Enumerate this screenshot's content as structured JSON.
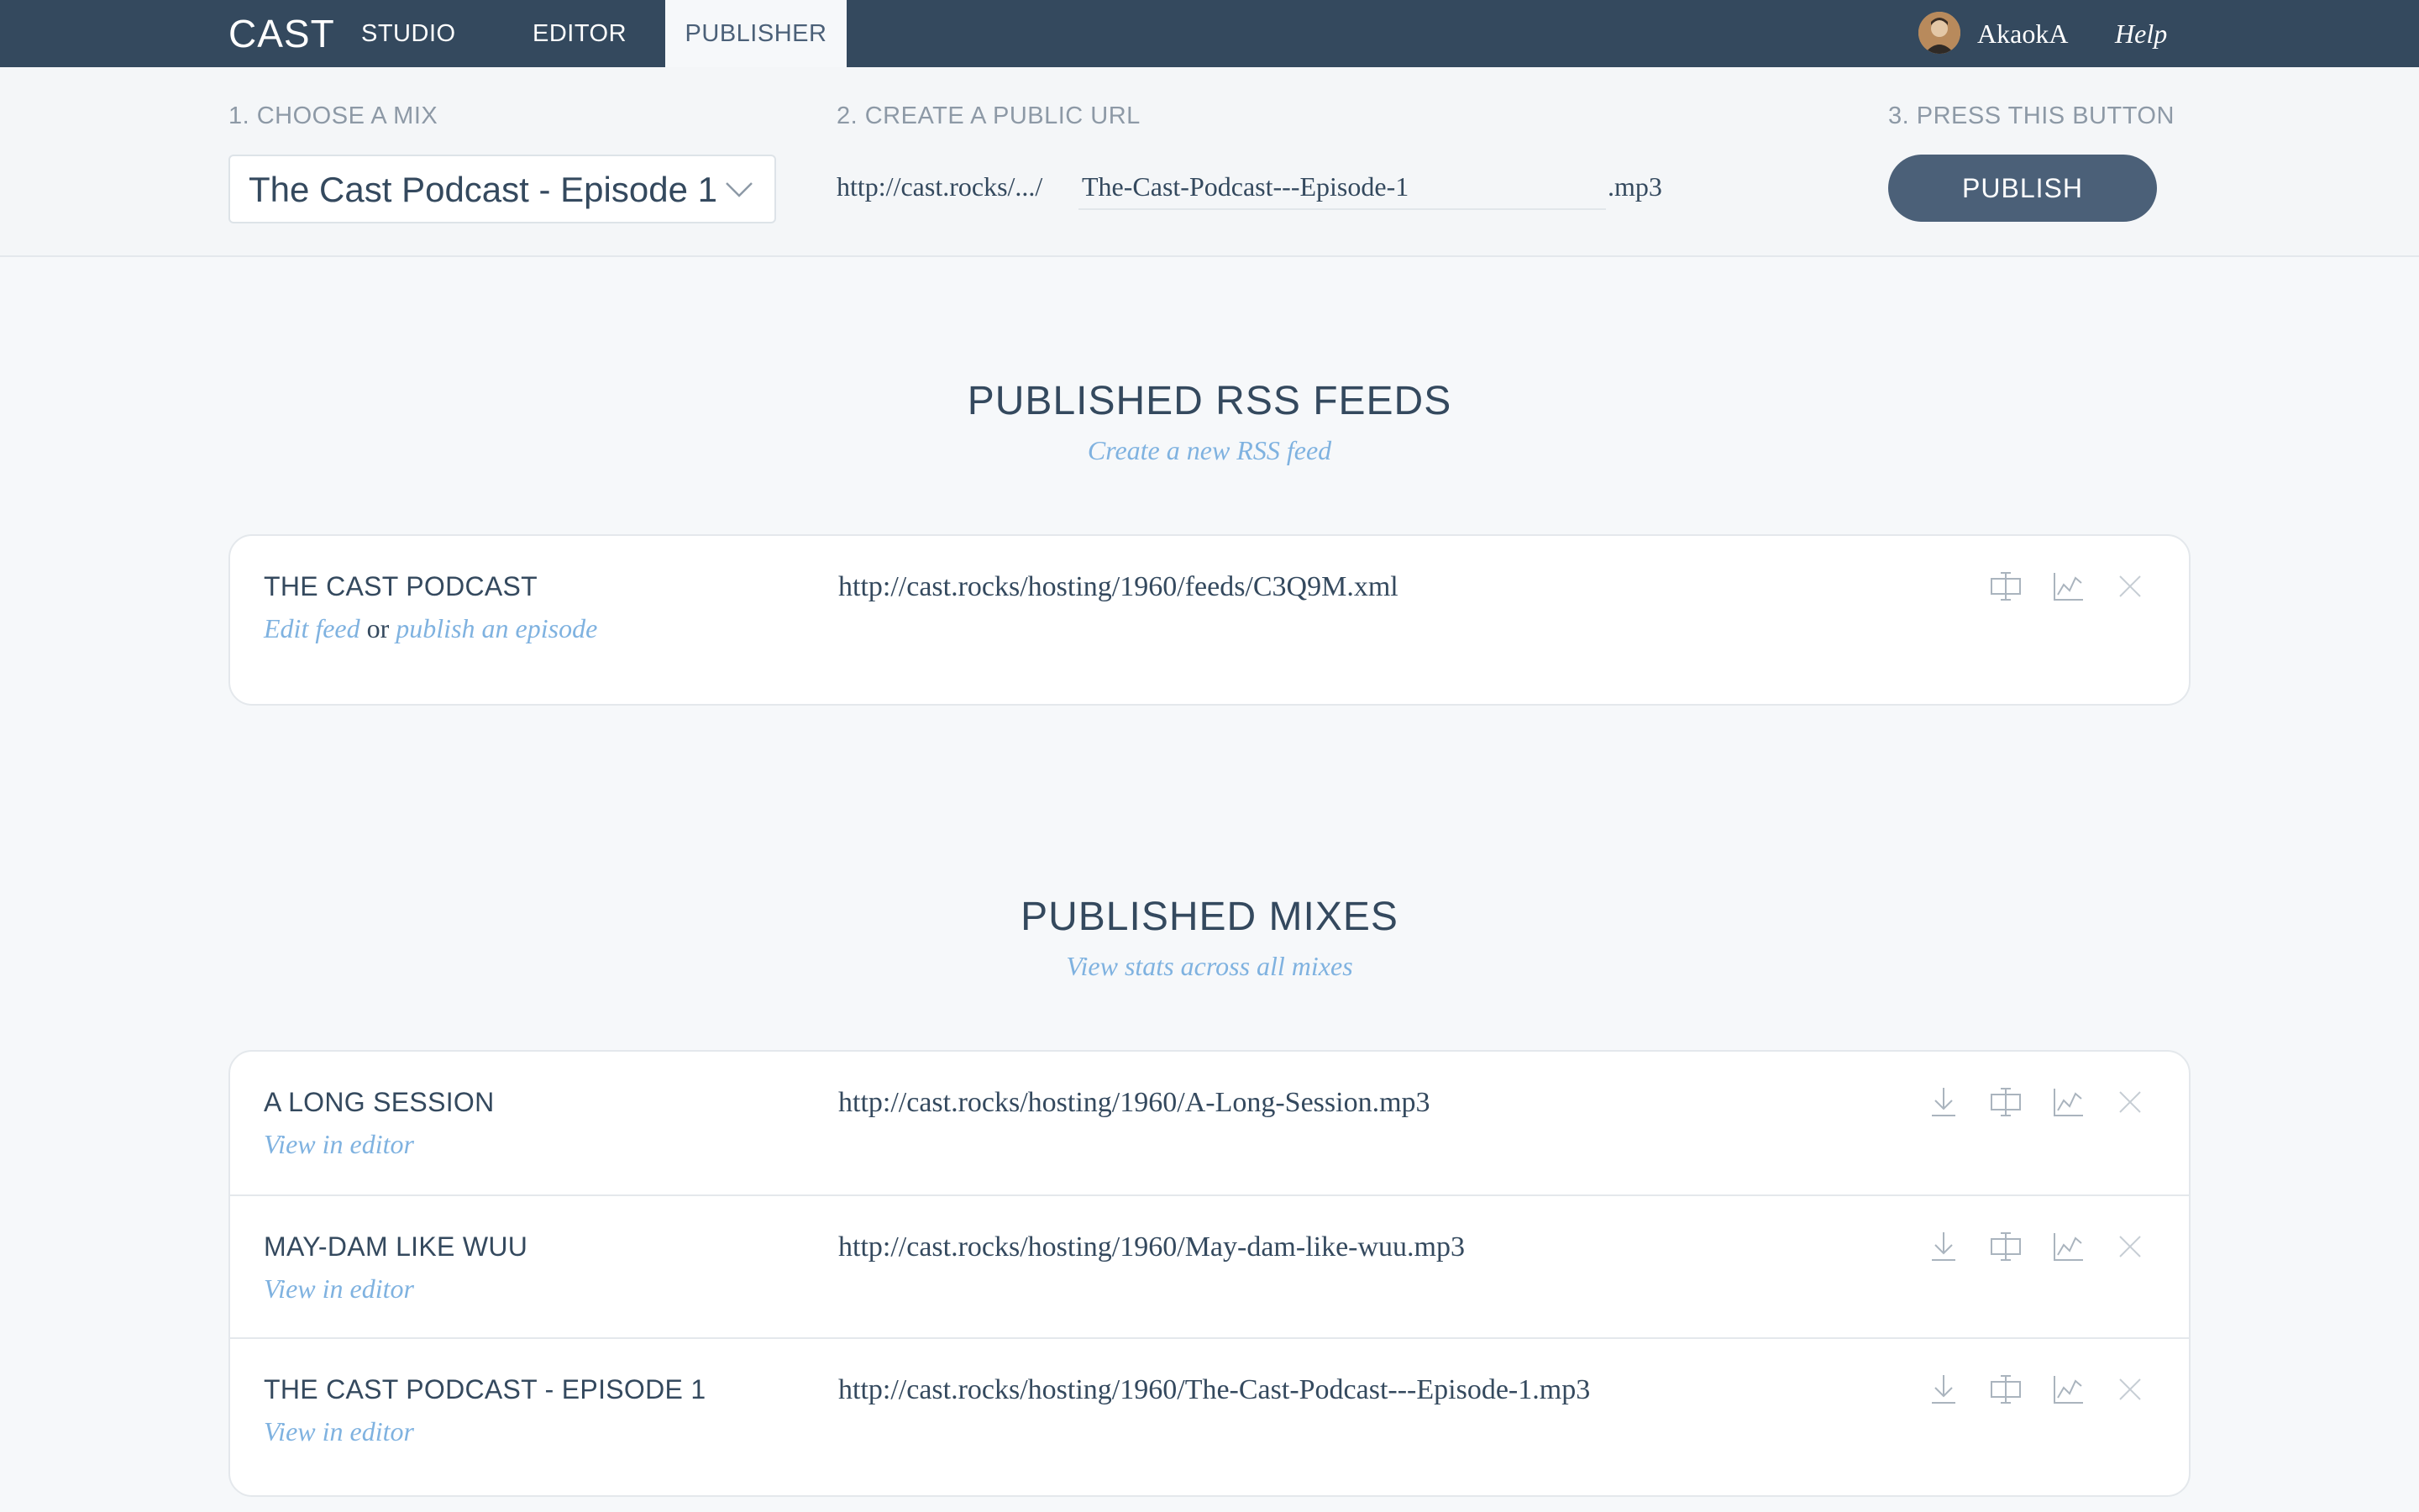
{
  "nav": {
    "logo": "CAST",
    "tabs": [
      {
        "label": "STUDIO"
      },
      {
        "label": "EDITOR"
      },
      {
        "label": "PUBLISHER"
      }
    ],
    "active_tab": "PUBLISHER",
    "user": {
      "name": "AkaokA",
      "avatar_icon": "user-avatar"
    },
    "help_label": "Help"
  },
  "publish_bar": {
    "step1_label": "1. CHOOSE A MIX",
    "step2_label": "2. CREATE A PUBLIC URL",
    "step3_label": "3. PRESS THIS BUTTON",
    "selected_mix": "The Cast Podcast - Episode 1",
    "url_prefix": "http://cast.rocks/.../",
    "url_slug": "The-Cast-Podcast---Episode-1",
    "url_suffix": ".mp3",
    "publish_label": "PUBLISH"
  },
  "rss_section": {
    "title": "PUBLISHED RSS FEEDS",
    "link": "Create a new RSS feed",
    "feeds": [
      {
        "name": "THE CAST PODCAST",
        "edit_label": "Edit feed",
        "or_label": "or",
        "publish_label": "publish an episode",
        "url": "http://cast.rocks/hosting/1960/feeds/C3Q9M.xml",
        "icons": [
          "embed-icon",
          "stats-icon",
          "delete-icon"
        ]
      }
    ]
  },
  "mixes_section": {
    "title": "PUBLISHED MIXES",
    "link": "View stats across all mixes",
    "mixes": [
      {
        "name": "A LONG SESSION",
        "link": "View in editor",
        "url": "http://cast.rocks/hosting/1960/A-Long-Session.mp3"
      },
      {
        "name": "MAY-DAM LIKE WUU",
        "link": "View in editor",
        "url": "http://cast.rocks/hosting/1960/May-dam-like-wuu.mp3"
      },
      {
        "name": "THE CAST PODCAST - EPISODE 1",
        "link": "View in editor",
        "url": "http://cast.rocks/hosting/1960/The-Cast-Podcast---Episode-1.mp3"
      }
    ],
    "row_icons": [
      "download-icon",
      "embed-icon",
      "stats-icon",
      "delete-icon"
    ]
  },
  "colors": {
    "nav_bg": "#34495e",
    "page_bg": "#f6f8fa",
    "accent_link": "#7fb2e0",
    "button_bg": "#4b6078",
    "icon_gray": "#aab4be"
  }
}
